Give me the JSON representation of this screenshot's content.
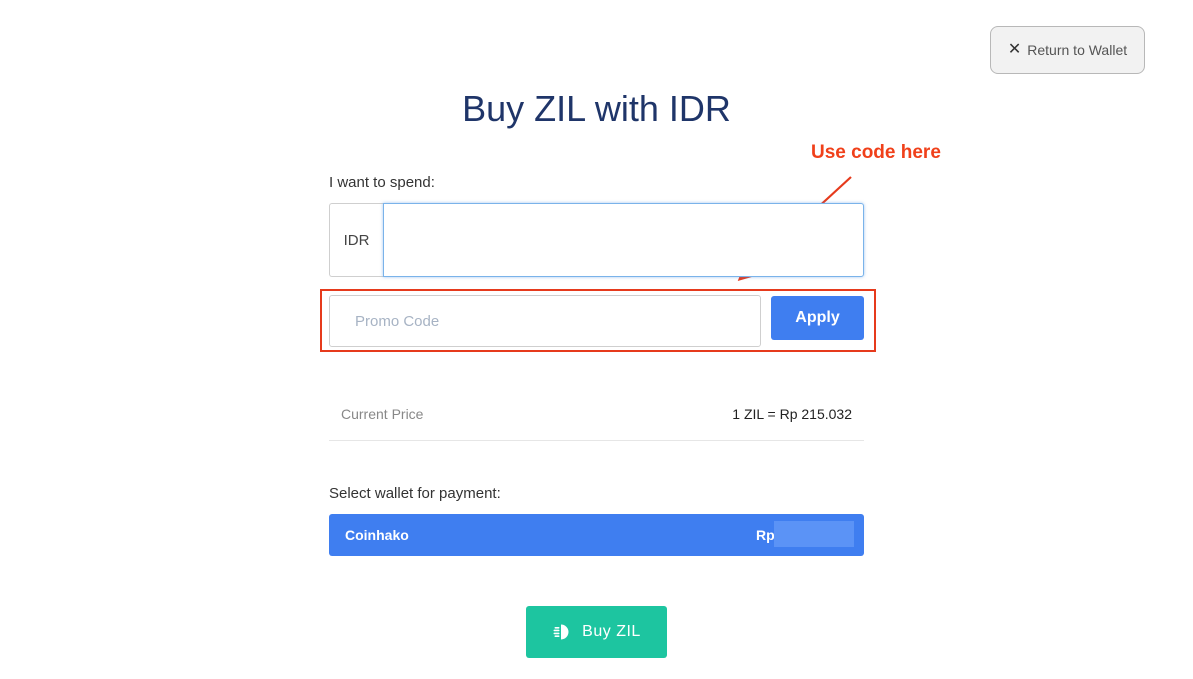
{
  "header": {
    "return_label": "Return to Wallet",
    "close_icon": "close-icon",
    "title": "Buy ZIL with IDR"
  },
  "annotation": {
    "text": "Use code here",
    "color": "#f0401a"
  },
  "spend": {
    "label": "I want to spend:",
    "currency": "IDR",
    "amount": ""
  },
  "promo": {
    "placeholder": "Promo Code",
    "value": "",
    "apply_label": "Apply"
  },
  "price": {
    "label": "Current Price",
    "value": "1 ZIL = Rp 215.032"
  },
  "wallet": {
    "label": "Select wallet for payment:",
    "name": "Coinhako",
    "currency": "Rp",
    "balance": ""
  },
  "buy": {
    "label": "Buy ZIL",
    "icon": "zil-coin-icon"
  },
  "colors": {
    "title": "#1f3569",
    "primary": "#3f7ef0",
    "buy": "#1dc5a0",
    "annotation": "#e63a1c"
  }
}
